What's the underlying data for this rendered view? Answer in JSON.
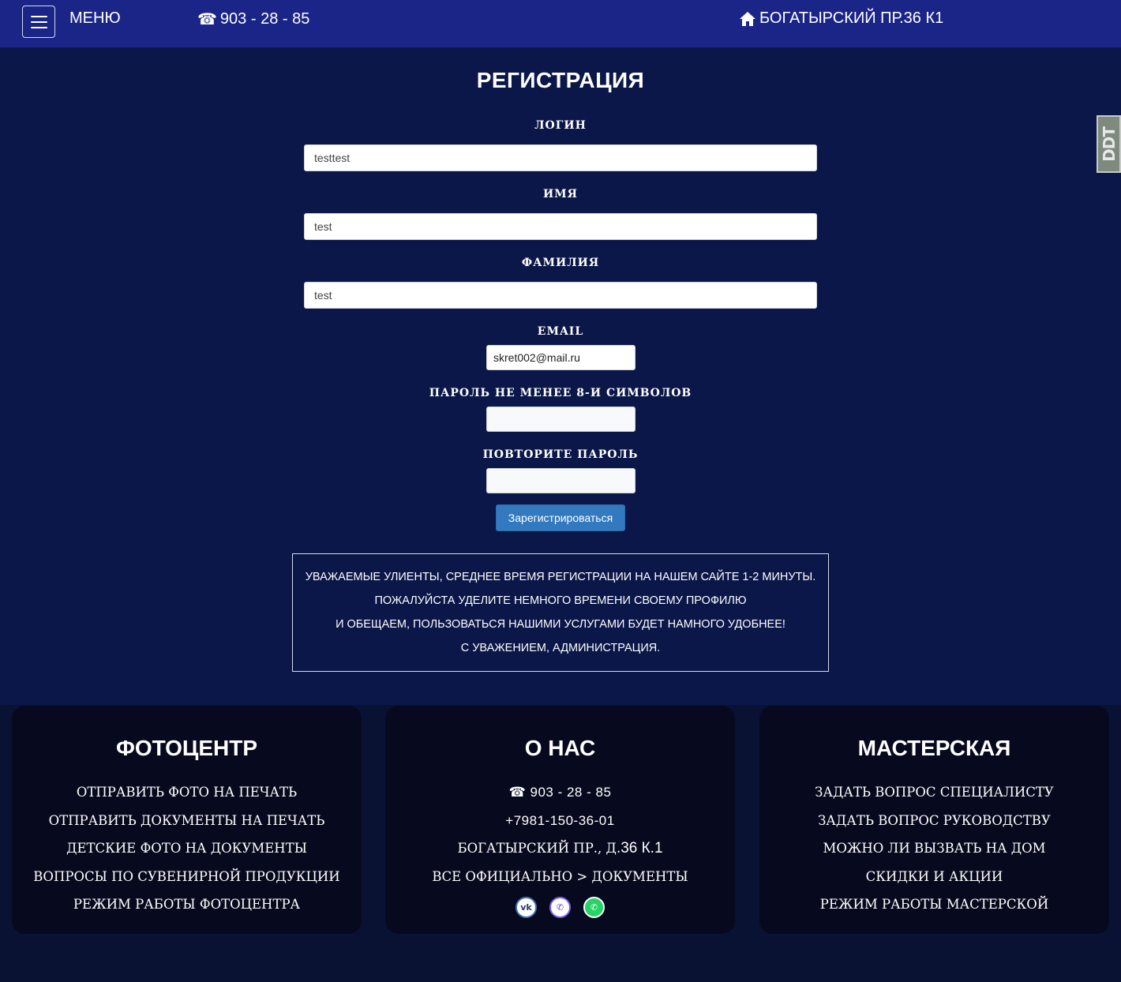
{
  "header": {
    "menu_label": "МЕНЮ",
    "phone": "903 - 28 - 85",
    "address": "БОГАТЫРСКИЙ ПР.36 К1",
    "phone_icon": "☎",
    "home_icon": "⌂"
  },
  "badge": {
    "text": "DDT"
  },
  "form": {
    "title": "РЕГИСТРАЦИЯ",
    "login_label": "ЛОГИН",
    "login_value": "testtest",
    "name_label": "ИМЯ",
    "name_value": "test",
    "surname_label": "ФАМИЛИЯ",
    "surname_value": "test",
    "email_label": "EMAIL",
    "email_value": "skret002@mail.ru",
    "password_label": "ПАРОЛЬ НЕ МЕНЕЕ 8-И СИМВОЛОВ",
    "password_repeat_label": "ПОВТОРИТЕ ПАРОЛЬ",
    "submit_label": "Зарегистрироваться"
  },
  "notice": {
    "lines": [
      "УВАЖАЕМЫЕ УЛИЕНТЫ, СРЕДНЕЕ ВРЕМЯ РЕГИСТРАЦИИ НА НАШЕМ САЙТЕ 1-2 МИНУТЫ.",
      "ПОЖАЛУЙСТА УДЕЛИТЕ НЕМНОГО ВРЕМЕНИ СВОЕМУ ПРОФИЛЮ",
      "И ОБЕЩАЕМ, ПОЛЬЗОВАТЬСЯ НАШИМИ УСЛУГАМИ БУДЕТ НАМНОГО УДОБНЕЕ!",
      "С УВАЖЕНИЕМ, АДМИНИСТРАЦИЯ."
    ]
  },
  "footer": {
    "photocenter": {
      "title": "ФОТОЦЕНТР",
      "items": [
        "ОТПРАВИТЬ ФОТО НА ПЕЧАТЬ",
        "ОТПРАВИТЬ ДОКУМЕНТЫ НА ПЕЧАТЬ",
        "ДЕТСКИЕ ФОТО НА ДОКУМЕНТЫ",
        "ВОПРОСЫ ПО СУВЕНИРНОЙ ПРОДУКЦИИ",
        "РЕЖИМ РАБОТЫ ФОТОЦЕНТРА"
      ]
    },
    "about": {
      "title": "О НАС",
      "phone": "903 - 28 - 85",
      "mobile": "+7981-150-36-01",
      "address_prefix": "БОГАТЫРСКИЙ ПР., Д.",
      "address_number": "36 К.1",
      "documents": "ВСЕ ОФИЦИАЛЬНО > ДОКУМЕНТЫ",
      "social": [
        "vk",
        "viber",
        "whatsapp"
      ]
    },
    "workshop": {
      "title": "МАСТЕРСКАЯ",
      "items": [
        "ЗАДАТЬ ВОПРОС СПЕЦИАЛИСТУ",
        "ЗАДАТЬ ВОПРОС РУКОВОДСТВУ",
        "МОЖНО ЛИ ВЫЗВАТЬ НА ДОМ",
        "СКИДКИ И АКЦИИ",
        "РЕЖИМ РАБОТЫ МАСТЕРСКОЙ"
      ]
    }
  },
  "colors": {
    "topbar": "#1b2588",
    "page_bg": "#0a1748",
    "card_bg": "#070a1e",
    "button": "#3379c0"
  }
}
